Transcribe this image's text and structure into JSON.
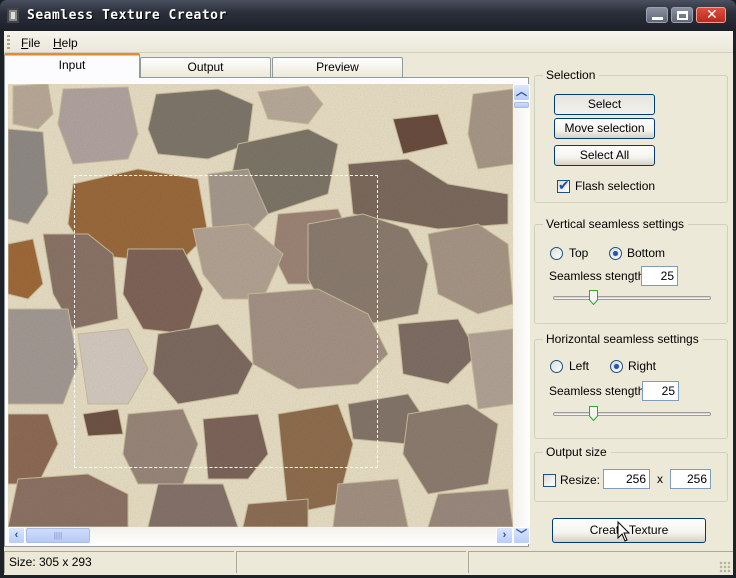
{
  "window": {
    "title": "Seamless Texture Creator",
    "icon": "app-icon",
    "controls": [
      "minimize-icon",
      "maximize-icon",
      "close-icon"
    ]
  },
  "menu": {
    "items": [
      {
        "label": "File",
        "mnemonic": "F",
        "rest": "ile"
      },
      {
        "label": "Help",
        "mnemonic": "H",
        "rest": "elp"
      }
    ]
  },
  "tabs": [
    {
      "label": "Input",
      "active": true
    },
    {
      "label": "Output",
      "active": false
    },
    {
      "label": "Preview",
      "active": false
    }
  ],
  "canvas": {
    "content": "stone-wall texture image",
    "colors": {
      "mortar": "#e6dbbd",
      "stone_grey": "#8e8578",
      "stone_brown": "#7d6658",
      "stone_ochre": "#a06a34"
    }
  },
  "selection_group": {
    "title": "Selection",
    "select_label": "Select",
    "move_label": "Move selection",
    "select_all_label": "Select All",
    "flash_label": "Flash selection",
    "flash_checked": true
  },
  "vertical": {
    "title": "Vertical seamless settings",
    "options": [
      "Top",
      "Bottom"
    ],
    "selected": "Bottom",
    "strength_label": "Seamless stength:",
    "strength_value": "25",
    "slider_fraction": 0.25
  },
  "horizontal": {
    "title": "Horizontal seamless settings",
    "options": [
      "Left",
      "Right"
    ],
    "selected": "Right",
    "strength_label": "Seamless stength:",
    "strength_value": "25",
    "slider_fraction": 0.25
  },
  "output": {
    "title": "Output size",
    "resize_label": "Resize:",
    "resize_checked": false,
    "width": "256",
    "x_label": "x",
    "height": "256"
  },
  "create_button": "Create Texture",
  "status": {
    "size_text": "Size: 305 x 293",
    "panel2": "",
    "panel3": ""
  },
  "scrollbars": {
    "vertical_position": 0,
    "horizontal_position": 0
  }
}
